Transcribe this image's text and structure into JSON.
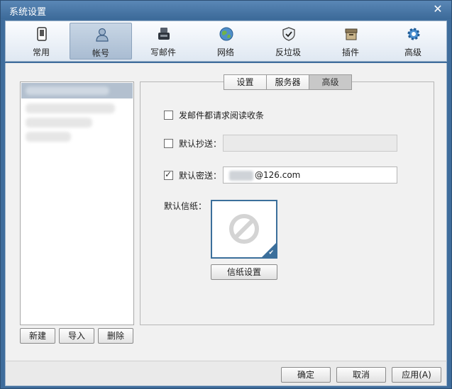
{
  "window": {
    "title": "系统设置"
  },
  "toolbar": {
    "items": [
      {
        "label": "常用",
        "icon": "phone-icon"
      },
      {
        "label": "帐号",
        "icon": "user-icon"
      },
      {
        "label": "写邮件",
        "icon": "compose-icon"
      },
      {
        "label": "网络",
        "icon": "globe-icon"
      },
      {
        "label": "反垃圾",
        "icon": "shield-icon"
      },
      {
        "label": "插件",
        "icon": "plugin-box-icon"
      },
      {
        "label": "高级",
        "icon": "gear-icon"
      }
    ],
    "active": "帐号"
  },
  "account_actions": {
    "new": "新建",
    "import": "导入",
    "delete": "删除"
  },
  "tabs": [
    {
      "label": "设置"
    },
    {
      "label": "服务器"
    },
    {
      "label": "高级",
      "active": true
    }
  ],
  "options": {
    "read_receipt": {
      "label": "发邮件都请求阅读收条",
      "checked": false
    },
    "default_cc": {
      "label": "默认抄送：",
      "checked": false,
      "value": ""
    },
    "default_bcc": {
      "label": "默认密送：",
      "checked": true,
      "value": "@126.com"
    },
    "stationery": {
      "label": "默认信纸：",
      "button": "信纸设置"
    }
  },
  "footer": {
    "ok": "确定",
    "cancel": "取消",
    "apply": "应用(A)"
  },
  "colors": {
    "titlebar": "#3c6a99",
    "active_tab": "#c8c8c8",
    "accent": "#3b6f9b"
  }
}
